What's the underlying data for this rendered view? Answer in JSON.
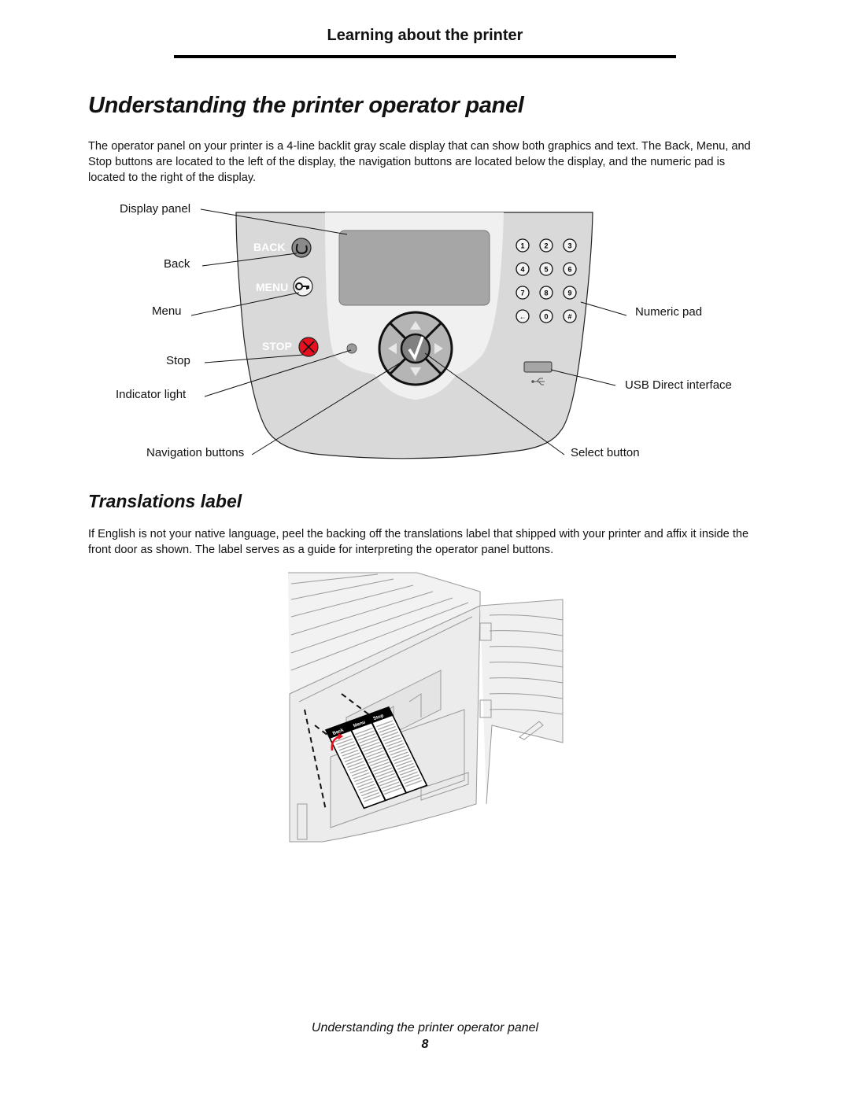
{
  "header": {
    "section_title": "Learning about the printer"
  },
  "main": {
    "title": "Understanding the printer operator panel",
    "intro": "The operator panel on your printer is a 4-line backlit gray scale display that can show both graphics and text. The Back, Menu, and Stop buttons are located to the left of the display, the navigation buttons are located below the display, and the numeric pad is located to the right of the display.",
    "figure_operator_panel": {
      "callouts": {
        "display_panel": "Display panel",
        "back": "Back",
        "menu": "Menu",
        "stop": "Stop",
        "indicator_light": "Indicator light",
        "navigation_buttons": "Navigation buttons",
        "numeric_pad": "Numeric pad",
        "usb_direct": "USB Direct interface",
        "select_button": "Select button"
      },
      "panel_buttons": {
        "back": "BACK",
        "menu": "MENU",
        "stop": "STOP"
      },
      "keypad": [
        "1",
        "2",
        "3",
        "4",
        "5",
        "6",
        "7",
        "8",
        "9",
        "←",
        "0",
        "#"
      ],
      "colors": {
        "stop_red": "#e8101e",
        "panel_gray": "#d8d8d8",
        "display_gray": "#a6a6a6"
      }
    },
    "translations_section": {
      "title": "Translations label",
      "body": "If English is not your native language, peel the backing off the translations label that shipped with your printer and affix it inside the front door as shown. The label serves as a guide for interpreting the operator panel buttons.",
      "label_columns": [
        "Back",
        "Menu",
        "Stop"
      ]
    }
  },
  "footer": {
    "title": "Understanding the printer operator panel",
    "page_number": "8"
  }
}
